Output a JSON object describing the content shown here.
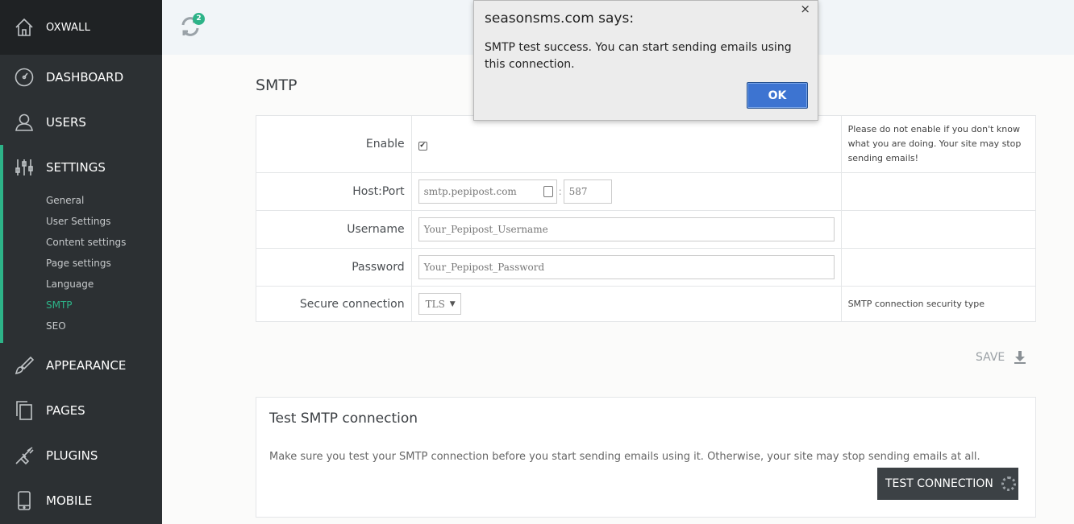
{
  "sidebar": {
    "brand": "OXWALL",
    "items": {
      "dashboard": "DASHBOARD",
      "users": "USERS",
      "settings": "SETTINGS",
      "appearance": "APPEARANCE",
      "pages": "PAGES",
      "plugins": "PLUGINS",
      "mobile": "MOBILE"
    },
    "settings_sub": [
      "General",
      "User Settings",
      "Content settings",
      "Page settings",
      "Language",
      "SMTP",
      "SEO"
    ],
    "active_sub": "SMTP"
  },
  "topbar": {
    "badge_count": "2"
  },
  "smtp": {
    "title": "SMTP",
    "rows": {
      "enable": {
        "label": "Enable",
        "checked": true,
        "desc": "Please do not enable if you don't know what you are doing. Your site may stop sending emails!"
      },
      "host_port": {
        "label": "Host:Port",
        "host": "smtp.pepipost.com",
        "separator": ":",
        "port": "587"
      },
      "username": {
        "label": "Username",
        "value": "Your_Pepipost_Username"
      },
      "password": {
        "label": "Password",
        "value": "Your_Pepipost_Password"
      },
      "secure": {
        "label": "Secure connection",
        "value": "TLS",
        "desc": "SMTP connection security type"
      }
    },
    "save_label": "SAVE"
  },
  "test": {
    "title": "Test SMTP connection",
    "desc": "Make sure you test your SMTP connection before you start sending emails using it. Otherwise, your site may stop sending emails at all.",
    "button": "TEST CONNECTION"
  },
  "dialog": {
    "title": "seasonsms.com says:",
    "close": "×",
    "message": "SMTP test success. You can start sending emails using this connection.",
    "ok": "OK"
  },
  "colors": {
    "accent": "#2db388",
    "sidebar_bg": "#2c3033",
    "ok_button": "#3d74d1"
  }
}
